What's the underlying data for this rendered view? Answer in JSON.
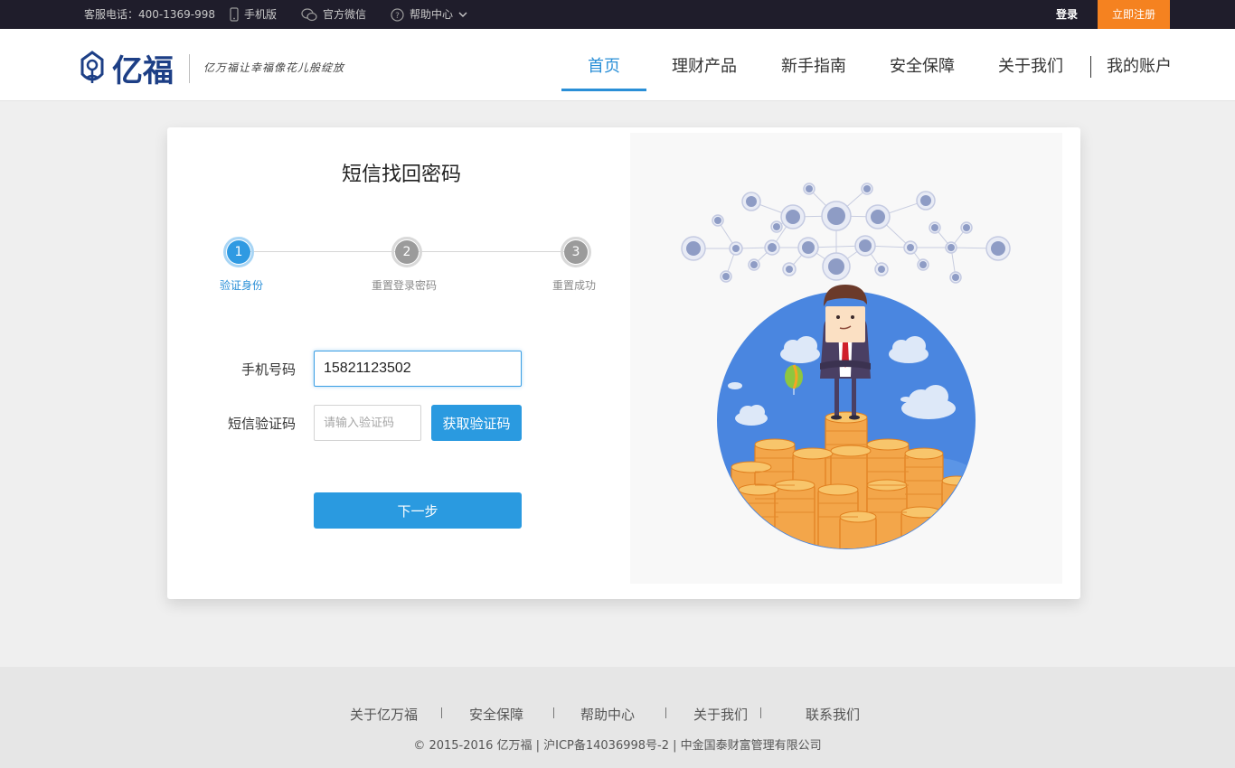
{
  "topbar": {
    "hotline": "客服电话：400-1369-998",
    "mobile": "手机版",
    "wechat": "官方微信",
    "help": "帮助中心",
    "login": "登录",
    "register": "立即注册"
  },
  "header": {
    "logo_text": "亿福",
    "slogan": "亿万福让幸福像花儿般绽放",
    "nav": [
      "首页",
      "理财产品",
      "新手指南",
      "安全保障",
      "关于我们",
      "我的账户"
    ],
    "active_nav": "首页",
    "accent": "#2a8fd7"
  },
  "form": {
    "title": "短信找回密码",
    "steps": [
      {
        "number": "1",
        "label": "验证身份",
        "active": true
      },
      {
        "number": "2",
        "label": "重置登录密码",
        "active": false
      },
      {
        "number": "3",
        "label": "重置成功",
        "active": false
      }
    ],
    "phone_label": "手机号码",
    "phone_value": "15821123502",
    "code_label": "短信验证码",
    "code_placeholder": "请输入验证码",
    "get_code": "获取验证码",
    "next": "下一步"
  },
  "footer": {
    "links": [
      "关于亿万福",
      "安全保障",
      "帮助中心",
      "关于我们",
      "联系我们"
    ],
    "copyright": "© 2015-2016 亿万福 | 沪ICP备14036998号-2 | 中金国泰财富管理有限公司"
  }
}
